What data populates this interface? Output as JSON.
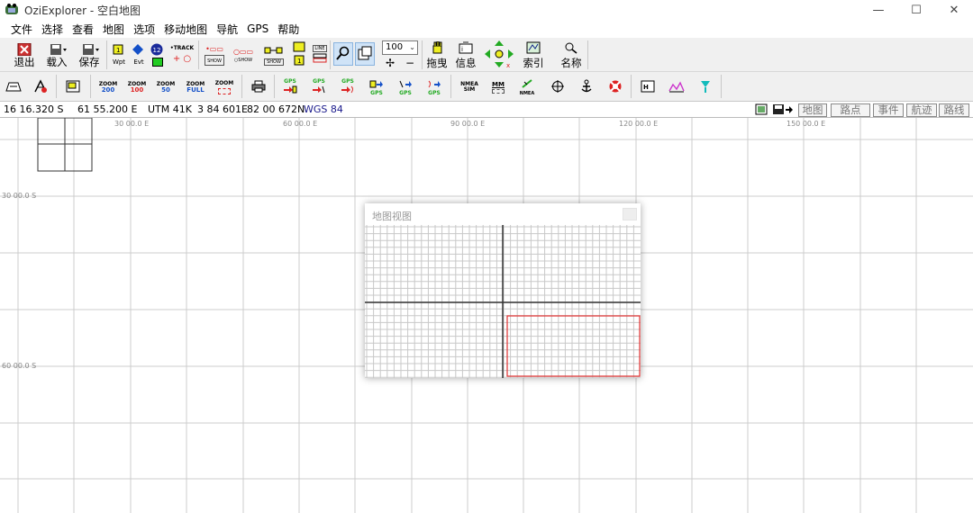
{
  "window": {
    "title": "OziExplorer - 空白地图",
    "minimize": "—",
    "maximize": "☐",
    "close": "✕"
  },
  "menu": [
    "文件",
    "选择",
    "查看",
    "地图",
    "选项",
    "移动地图",
    "导航",
    "GPS",
    "帮助"
  ],
  "toolbar1": {
    "exit": "退出",
    "load": "载入",
    "save": "保存",
    "wpt": "Wpt",
    "evt": "Evt",
    "track": "•TRACK",
    "show1": "SHOW",
    "show2": "○SHOW",
    "show3": "SHOW",
    "line": "LINE",
    "zoom_value": "100",
    "drag": "拖曳",
    "info": "信息",
    "index": "索引",
    "name": "名称",
    "badge": "12"
  },
  "toolbar2": {
    "zoom200": [
      "ZOOM",
      "200"
    ],
    "zoom100": [
      "ZOOM",
      "100"
    ],
    "zoom50": [
      "ZOOM",
      "50"
    ],
    "zoomfull": [
      "ZOOM",
      "FULL"
    ],
    "zoom": "ZOOM",
    "gps": "GPS",
    "nmea_sim": [
      "NMEA",
      "SIM"
    ],
    "mm": "MM",
    "nmea": "NMEA"
  },
  "coords": {
    "lat": "16 16.320 S",
    "lon": "61 55.200 E",
    "utm": "UTM  41K",
    "easting": "3 84 601E",
    "northing": "82 00 672N",
    "datum": "WGS 84"
  },
  "tabs": [
    "地图",
    "路点",
    "事件",
    "航迹",
    "路线"
  ],
  "map": {
    "lon_labels": [
      "30 00.0 E",
      "60 00.0 E",
      "90 00.0 E",
      "120 00.0 E",
      "150 00.0 E"
    ],
    "lat_labels": [
      "30 00.0 S",
      "60 00.0 S"
    ]
  },
  "mapview": {
    "title": "地图视图"
  },
  "colors": {
    "grid": "#c8c8c8",
    "viewport_rect": "#e03030",
    "datum": "#1a1a8c"
  }
}
